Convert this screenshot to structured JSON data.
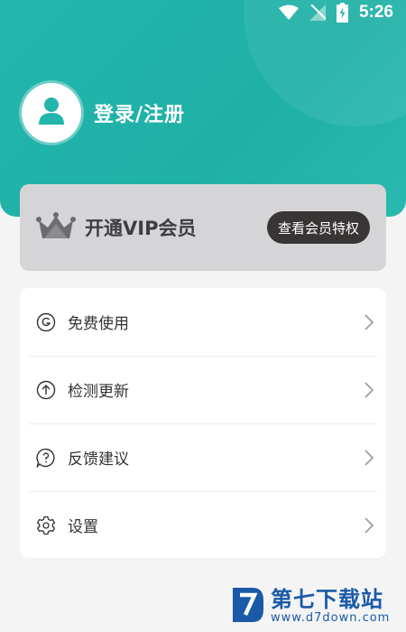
{
  "status_bar": {
    "time": "5:26",
    "icons": [
      "wifi-icon",
      "signal-icon",
      "battery-charging-icon"
    ]
  },
  "profile": {
    "avatar_icon": "user-icon",
    "login_label": "登录/注册"
  },
  "vip": {
    "icon": "crown-icon",
    "title": "开通VIP会员",
    "button_label": "查看会员特权"
  },
  "menu": {
    "items": [
      {
        "icon": "g-circle-icon",
        "label": "免费使用"
      },
      {
        "icon": "upload-circle-icon",
        "label": "检测更新"
      },
      {
        "icon": "question-chat-icon",
        "label": "反馈建议"
      },
      {
        "icon": "gear-icon",
        "label": "设置"
      }
    ]
  },
  "watermark": {
    "title": "第七下载站",
    "url": "www.d7down.com"
  },
  "colors": {
    "header": "#22b6ac",
    "vip_card": "#d5d5d7",
    "vip_button": "#3a3535",
    "page_bg": "#f4f4f5",
    "watermark": "#1a5aa8"
  }
}
